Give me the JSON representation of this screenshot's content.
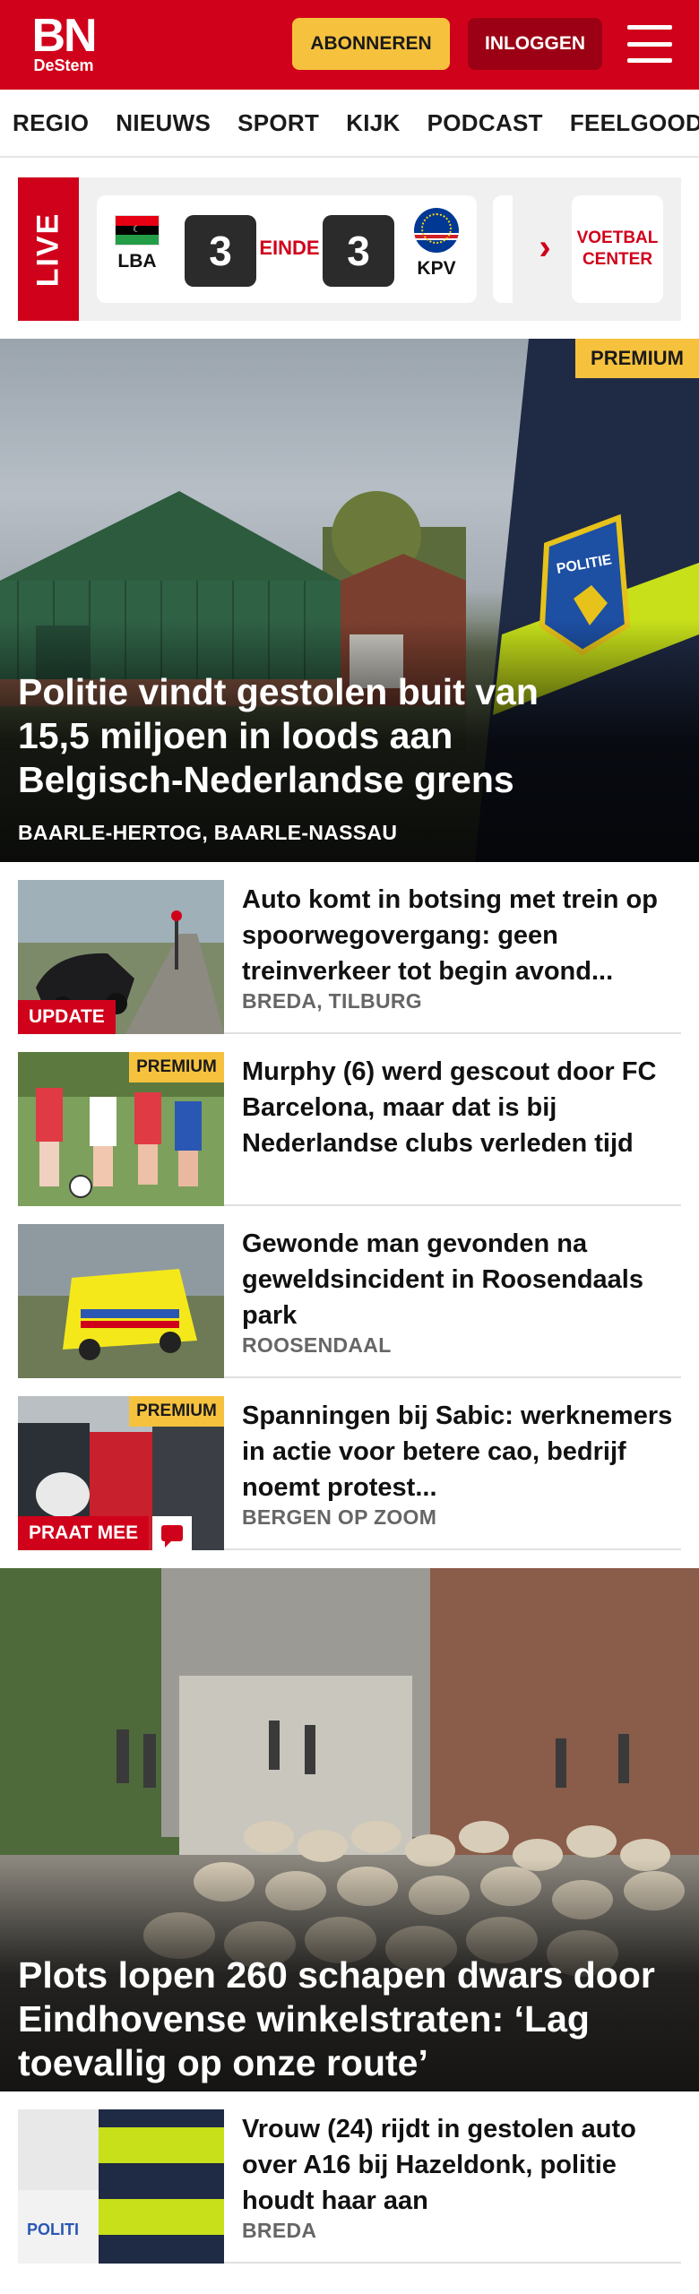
{
  "header": {
    "logo_main": "BN",
    "logo_sub": "DeStem",
    "subscribe_label": "ABONNEREN",
    "login_label": "INLOGGEN",
    "menu_icon": "hamburger-icon"
  },
  "nav": {
    "items": [
      "REGIO",
      "NIEUWS",
      "SPORT",
      "KIJK",
      "PODCAST",
      "FEELGOOD"
    ]
  },
  "live": {
    "label": "LIVE",
    "match": {
      "home_code": "LBA",
      "away_code": "KPV",
      "home_score": "3",
      "away_score": "3",
      "status": "EINDE"
    },
    "football_center_label": "VOETBAL CENTER",
    "next_icon": "chevron-right-icon"
  },
  "hero": {
    "badge": "PREMIUM",
    "title": "Politie vindt gestolen buit van 15,5 miljoen in loods aan Belgisch-Nederlandse grens",
    "location": "BAARLE-HERTOG, BAARLE-NASSAU"
  },
  "articles": [
    {
      "title": "Auto komt in botsing met trein op spoorwegovergang: geen treinverkeer tot begin avond...",
      "location": "BREDA, TILBURG",
      "tag": "UPDATE"
    },
    {
      "title": "Murphy (6) werd gescout door FC Barcelona, maar dat is bij Nederlandse clubs verleden tijd",
      "badge": "PREMIUM"
    },
    {
      "title": "Gewonde man gevonden na geweldsincident in Roosendaals park",
      "location": "ROOSENDAAL"
    },
    {
      "title": "Spanningen bij Sabic: werknemers in actie voor betere cao, bedrijf noemt protest...",
      "location": "BERGEN OP ZOOM",
      "badge": "PREMIUM",
      "tag": "PRAAT MEE"
    }
  ],
  "hero2": {
    "title": "Plots lopen 260 schapen dwars door Eindhovense winkelstraten: ‘Lag toevallig op onze route’"
  },
  "articles2": [
    {
      "title": "Vrouw (24) rijdt in gestolen auto over A16 bij Hazeldonk, politie houdt haar aan",
      "location": "BREDA"
    }
  ],
  "colors": {
    "brand_red": "#d0021b",
    "subscribe_yellow": "#f6c23e",
    "login_dark_red": "#9b0014"
  }
}
